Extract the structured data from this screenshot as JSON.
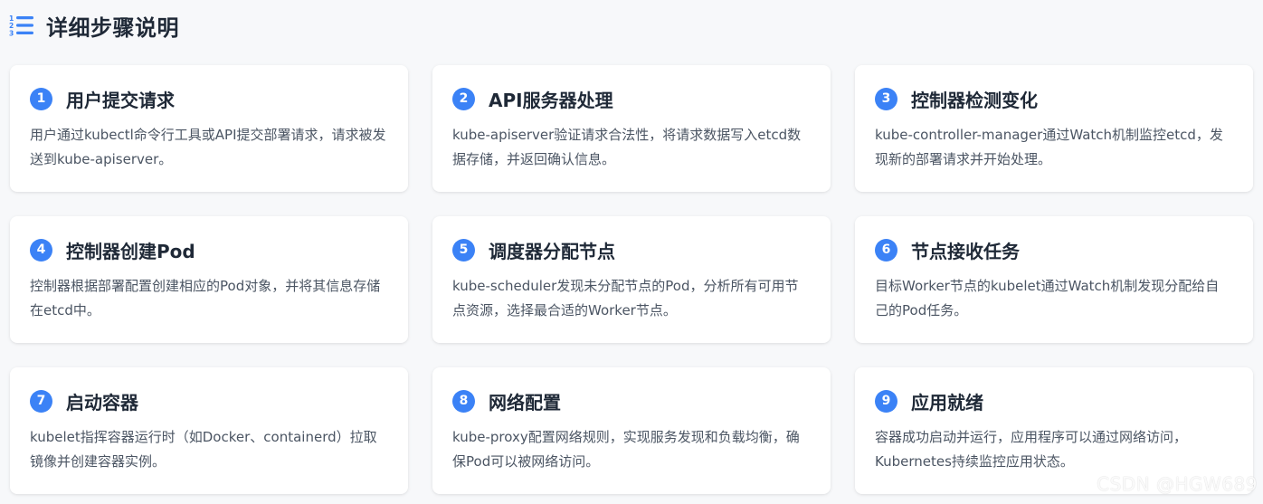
{
  "header": {
    "title": "详细步骤说明",
    "icon": "numbered-list-icon",
    "accent_color": "#3b82f6"
  },
  "steps": [
    {
      "number": "1",
      "title": "用户提交请求",
      "description": "用户通过kubectl命令行工具或API提交部署请求，请求被发送到kube-apiserver。"
    },
    {
      "number": "2",
      "title": "API服务器处理",
      "description": "kube-apiserver验证请求合法性，将请求数据写入etcd数据存储，并返回确认信息。"
    },
    {
      "number": "3",
      "title": "控制器检测变化",
      "description": "kube-controller-manager通过Watch机制监控etcd，发现新的部署请求并开始处理。"
    },
    {
      "number": "4",
      "title": "控制器创建Pod",
      "description": "控制器根据部署配置创建相应的Pod对象，并将其信息存储在etcd中。"
    },
    {
      "number": "5",
      "title": "调度器分配节点",
      "description": "kube-scheduler发现未分配节点的Pod，分析所有可用节点资源，选择最合适的Worker节点。"
    },
    {
      "number": "6",
      "title": "节点接收任务",
      "description": "目标Worker节点的kubelet通过Watch机制发现分配给自己的Pod任务。"
    },
    {
      "number": "7",
      "title": "启动容器",
      "description": "kubelet指挥容器运行时（如Docker、containerd）拉取镜像并创建容器实例。"
    },
    {
      "number": "8",
      "title": "网络配置",
      "description": "kube-proxy配置网络规则，实现服务发现和负载均衡，确保Pod可以被网络访问。"
    },
    {
      "number": "9",
      "title": "应用就绪",
      "description": "容器成功启动并运行，应用程序可以通过网络访问，Kubernetes持续监控应用状态。"
    }
  ],
  "watermark": "CSDN @HGW689"
}
